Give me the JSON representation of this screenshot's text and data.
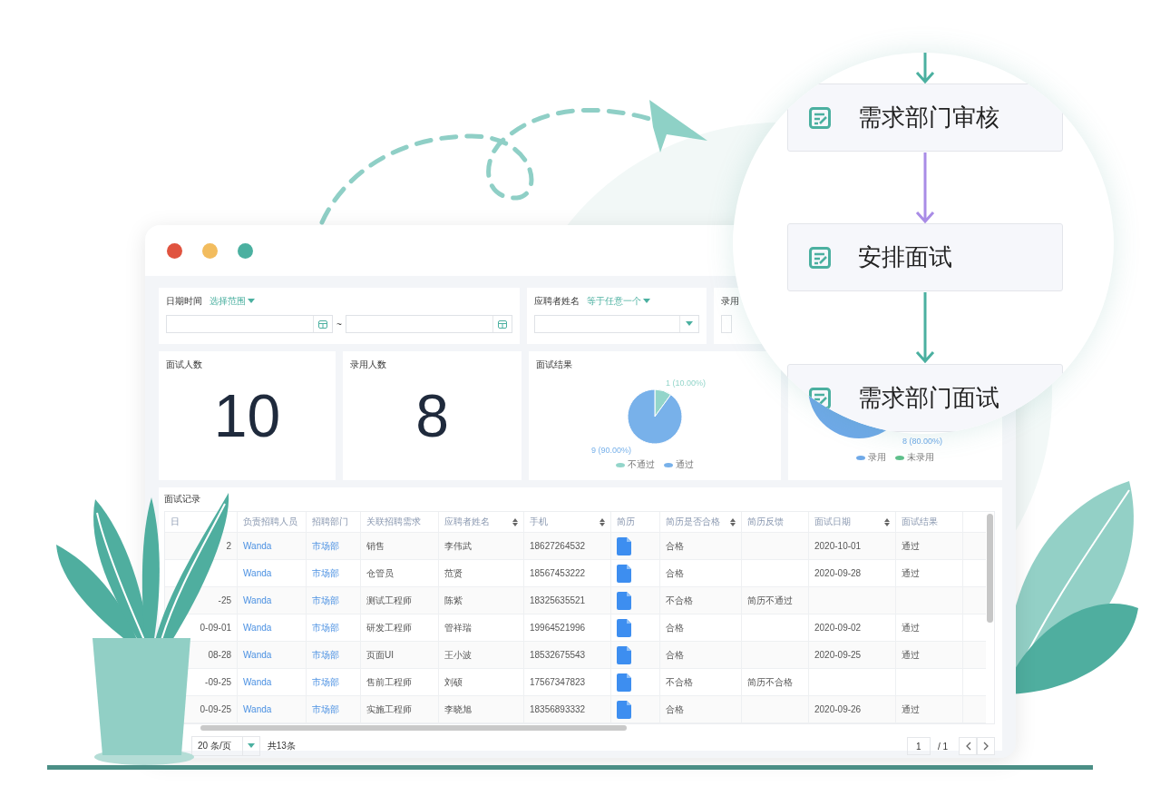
{
  "window": {
    "controls": [
      {
        "color": "#e0533f"
      },
      {
        "color": "#f2bc5e"
      },
      {
        "color": "#4bb0a0"
      }
    ]
  },
  "filters": [
    {
      "kind": "date_range",
      "label": "日期时间",
      "mode": "选择范围",
      "separator": "~"
    },
    {
      "kind": "select",
      "label": "应聘者姓名",
      "mode": "等于任意一个"
    },
    {
      "kind": "partial",
      "label": "录用"
    }
  ],
  "stats": [
    {
      "kind": "number",
      "title": "面试人数",
      "value": "10"
    },
    {
      "kind": "number",
      "title": "录用人数",
      "value": "8"
    },
    {
      "kind": "pie",
      "title": "面试结果",
      "chart_data": {
        "type": "pie",
        "categories": [
          "不通过",
          "通过"
        ],
        "values": [
          10,
          90
        ],
        "colors": [
          "#93d5ca",
          "#78b1ea"
        ],
        "value_labels": [
          "1 (10.00%)",
          "9 (90.00%)"
        ]
      }
    },
    {
      "kind": "pie_partial",
      "label": "8 (80.00%)",
      "legend": [
        {
          "label": "录用",
          "color": "#6fa9e8"
        },
        {
          "label": "未录用",
          "color": "#5fc08c"
        }
      ]
    }
  ],
  "table": {
    "title": "面试记录",
    "columns": [
      {
        "label": "日",
        "kind": "text",
        "sortable": false
      },
      {
        "label": "负责招聘人员",
        "kind": "link",
        "sortable": false
      },
      {
        "label": "招聘部门",
        "kind": "link",
        "sortable": false
      },
      {
        "label": "关联招聘需求",
        "kind": "text",
        "sortable": false
      },
      {
        "label": "应聘者姓名",
        "kind": "text",
        "sortable": true
      },
      {
        "label": "手机",
        "kind": "text",
        "sortable": true
      },
      {
        "label": "简历",
        "kind": "file",
        "sortable": false
      },
      {
        "label": "简历是否合格",
        "kind": "text",
        "sortable": true
      },
      {
        "label": "简历反馈",
        "kind": "text",
        "sortable": false
      },
      {
        "label": "面试日期",
        "kind": "text",
        "sortable": true
      },
      {
        "label": "面试结果",
        "kind": "text",
        "sortable": false
      }
    ],
    "rows": [
      [
        "2",
        "Wanda",
        "市场部",
        "销售",
        "李伟武",
        "18627264532",
        true,
        "合格",
        null,
        "2020-10-01",
        "通过"
      ],
      [
        null,
        "Wanda",
        "市场部",
        "仓管员",
        "范贤",
        "18567453222",
        true,
        "合格",
        null,
        "2020-09-28",
        "通过"
      ],
      [
        "-25",
        "Wanda",
        "市场部",
        "测试工程师",
        "陈紫",
        "18325635521",
        true,
        "不合格",
        "简历不通过",
        null,
        null
      ],
      [
        "0-09-01",
        "Wanda",
        "市场部",
        "研发工程师",
        "管祥瑞",
        "19964521996",
        true,
        "合格",
        null,
        "2020-09-02",
        "通过"
      ],
      [
        "08-28",
        "Wanda",
        "市场部",
        "页面UI",
        "王小波",
        "18532675543",
        true,
        "合格",
        null,
        "2020-09-25",
        "通过"
      ],
      [
        "-09-25",
        "Wanda",
        "市场部",
        "售前工程师",
        "刘硕",
        "17567347823",
        true,
        "不合格",
        "简历不合格",
        null,
        null
      ],
      [
        "0-09-25",
        "Wanda",
        "市场部",
        "实施工程师",
        "李晓旭",
        "18356893332",
        true,
        "合格",
        null,
        "2020-09-26",
        "通过"
      ]
    ],
    "pagination": {
      "page_size": "20 条/页",
      "total": "共13条",
      "page": "1",
      "pages": "/ 1"
    }
  },
  "flow": {
    "nodes": [
      {
        "label": "需求部门审核"
      },
      {
        "label": "安排面试"
      },
      {
        "label": "需求部门面试"
      }
    ],
    "connectors": [
      {
        "color": "#4bb0a0"
      },
      {
        "color": "#a98ce6"
      },
      {
        "color": "#4bb0a0"
      }
    ]
  }
}
